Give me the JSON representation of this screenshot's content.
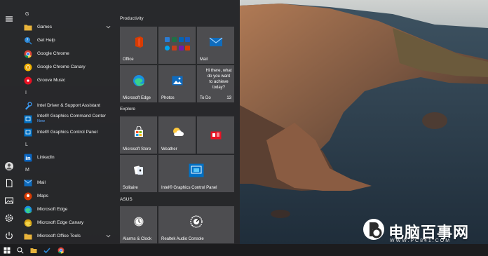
{
  "applist": {
    "sections": [
      {
        "letter": "G",
        "apps": [
          {
            "label": "Games",
            "icon": "folder-icon",
            "expandable": true
          },
          {
            "label": "Get Help",
            "icon": "get-help-icon"
          },
          {
            "label": "Google Chrome",
            "icon": "chrome-icon"
          },
          {
            "label": "Google Chrome Canary",
            "icon": "chrome-canary-icon"
          },
          {
            "label": "Groove Music",
            "icon": "groove-music-icon"
          }
        ]
      },
      {
        "letter": "I",
        "apps": [
          {
            "label": "Intel Driver & Support Assistant",
            "icon": "intel-driver-icon"
          },
          {
            "label": "Intel® Graphics Command Center",
            "sublabel": "New",
            "icon": "intel-graphics-icon"
          },
          {
            "label": "Intel® Graphics Control Panel",
            "icon": "intel-graphics-icon"
          }
        ]
      },
      {
        "letter": "L",
        "apps": [
          {
            "label": "LinkedIn",
            "icon": "linkedin-icon"
          }
        ]
      },
      {
        "letter": "M",
        "apps": [
          {
            "label": "Mail",
            "icon": "mail-icon"
          },
          {
            "label": "Maps",
            "icon": "maps-icon"
          },
          {
            "label": "Microsoft Edge",
            "icon": "edge-icon"
          },
          {
            "label": "Microsoft Edge Canary",
            "icon": "edge-canary-icon"
          },
          {
            "label": "Microsoft Office Tools",
            "icon": "folder-icon",
            "expandable": true
          }
        ]
      }
    ]
  },
  "groups": {
    "productivity": "Productivity",
    "explore": "Explore",
    "asus": "ASUS"
  },
  "tiles": {
    "office": "Office",
    "mail": "Mail",
    "edge": "Microsoft Edge",
    "photos": "Photos",
    "todo": "To Do",
    "todo_count": "13",
    "todo_text": "Hi there, what do you want to achieve today?",
    "store": "Microsoft Store",
    "weather": "Weather",
    "solitaire": "Solitaire",
    "intel_panel": "Intel® Graphics Control Panel",
    "alarms": "Alarms & Clock",
    "realtek": "Realtek Audio Console"
  },
  "watermark": {
    "title": "电脑百事网",
    "url": "WWW.PC841.COM"
  },
  "colors": {
    "accent": "#0078d4",
    "folder": "#e8b33b"
  }
}
